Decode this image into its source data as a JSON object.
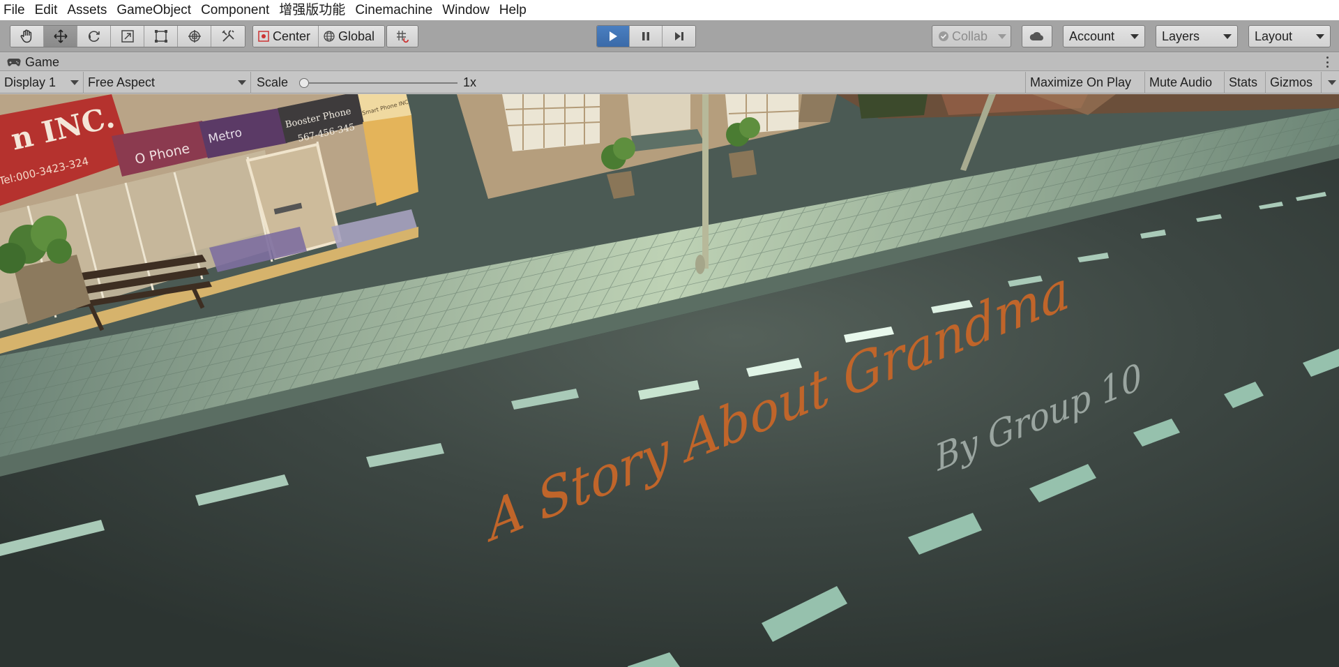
{
  "menu": {
    "items": [
      "File",
      "Edit",
      "Assets",
      "GameObject",
      "Component",
      "增强版功能",
      "Cinemachine",
      "Window",
      "Help"
    ]
  },
  "toolbar": {
    "tools": [
      "hand-tool-icon",
      "move-tool-icon",
      "rotate-tool-icon",
      "scale-tool-icon",
      "rect-tool-icon",
      "transform-tool-icon",
      "custom-tool-icon"
    ],
    "pivot_label": "Center",
    "space_label": "Global",
    "playback": [
      "play-icon",
      "pause-icon",
      "step-icon"
    ],
    "collab_label": "Collab",
    "account_label": "Account",
    "layers_label": "Layers",
    "layout_label": "Layout"
  },
  "game_tab": {
    "title": "Game"
  },
  "game_controls": {
    "display": "Display 1",
    "aspect": "Free Aspect",
    "scale_label": "Scale",
    "scale_value": "1x",
    "maximize": "Maximize On Play",
    "mute": "Mute Audio",
    "stats": "Stats",
    "gizmos": "Gizmos"
  },
  "scene": {
    "title_text": "A Story About Grandma",
    "subtitle_text": "By Group 10",
    "sign_inc": "n INC.",
    "sign_tel": "Tel:000-3423-324",
    "sign_ophone": "O Phone",
    "sign_metro": "Metro",
    "sign_booster": "Booster Phone",
    "sign_booster_phone": "567-456-345",
    "sign_smart": "Smart Phone INC",
    "colors": {
      "accent_play": "#3a6aa8",
      "title_orange": "#c0652a",
      "subtitle_grey": "#9aa5a0"
    }
  }
}
